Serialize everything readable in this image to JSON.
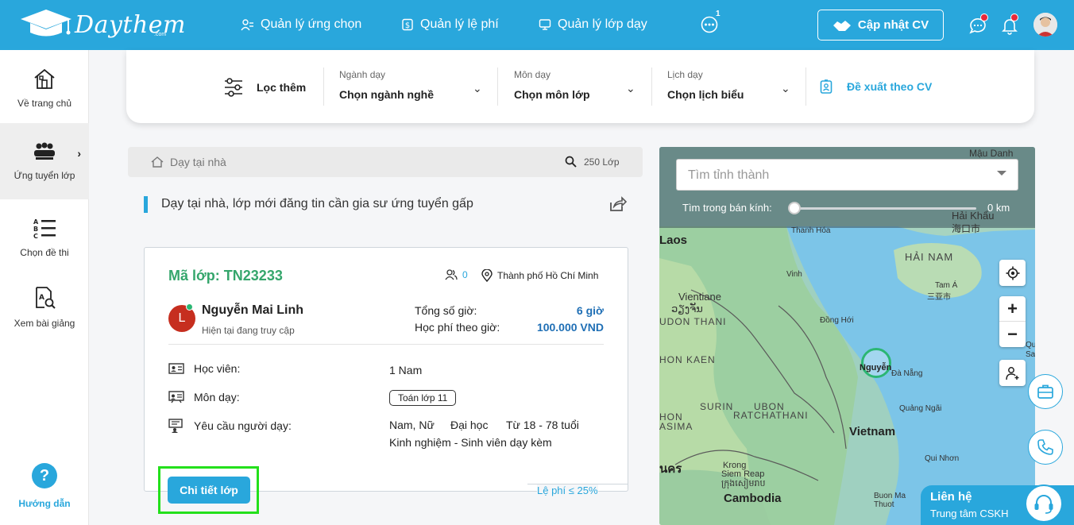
{
  "brand": {
    "name": "Daythem",
    "suffix": ".com"
  },
  "header": {
    "nav": [
      {
        "label": "Quản lý ứng chọn",
        "icon": "people-list-icon"
      },
      {
        "label": "Quản lý lệ phí",
        "icon": "dollar-doc-icon"
      },
      {
        "label": "Quản lý lớp dạy",
        "icon": "screen-icon"
      }
    ],
    "more_badge": "1",
    "cv_button": "Cập nhật CV"
  },
  "sidebar": {
    "items": [
      {
        "label": "Về trang chủ",
        "icon": "home-icon"
      },
      {
        "label": "Ứng tuyển lớp",
        "icon": "group-icon"
      },
      {
        "label": "Chọn đề thi",
        "icon": "abc-list-icon"
      },
      {
        "label": "Xem bài giảng",
        "icon": "lesson-search-icon"
      }
    ],
    "help": "Hướng dẫn",
    "help_symbol": "?"
  },
  "filter": {
    "more_label": "Lọc thêm",
    "groups": [
      {
        "label": "Ngành dạy",
        "value": "Chọn ngành nghề"
      },
      {
        "label": "Môn dạy",
        "value": "Chọn môn lớp"
      },
      {
        "label": "Lịch dạy",
        "value": "Chọn lịch biểu"
      }
    ],
    "suggest": "Đề xuất theo CV"
  },
  "search": {
    "placeholder": "Dạy tại nhà",
    "count": "250 Lớp"
  },
  "section_title": "Dạy tại nhà, lớp mới đăng tin cần gia sư ứng tuyển gấp",
  "card": {
    "code": "Mã lớp: TN23233",
    "applicants": "0",
    "location": "Thành phố Hồ Chí Minh",
    "tutor": {
      "initial": "L",
      "name": "Nguyễn Mai Linh",
      "status": "Hiện tại đang truy cập"
    },
    "total_hours_label": "Tổng số giờ:",
    "total_hours": "6 giờ",
    "fee_label": "Học phí theo giờ:",
    "fee": "100.000 VND",
    "student_label": "Học viên:",
    "student_value": "1 Nam",
    "subject_label": "Môn dạy:",
    "subject_value": "Toán lớp 11",
    "req_label": "Yêu cầu người dạy:",
    "req_gender": "Nam, Nữ",
    "req_level": "Đại học",
    "req_age": "Từ 18 - 78 tuổi",
    "req_exp": "Kinh nghiệm - Sinh viên dạy kèm",
    "detail_button": "Chi tiết lớp",
    "fee_note": "Lệ phí ≤ 25%"
  },
  "map": {
    "province_placeholder": "Tìm tỉnh thành",
    "radius_label": "Tìm trong bán kính:",
    "radius_value": "0 km",
    "radius_fraction": 0,
    "labels": {
      "mau_danh": "Mậu Danh",
      "hai_khau": "Hải Khẩu",
      "hai_khau_cn": "海口市",
      "laos": "Laos",
      "thanh_hoa": "Thanh Hóa",
      "hai_nam": "HẢI NAM",
      "vinh": "Vinh",
      "tam_a": "Tam Á",
      "tam_a_cn": "三亚市",
      "vientiane": "Vientiane",
      "vientiane_lo": "ວຽງຈັນ",
      "udon_thani": "UDON THANI",
      "dong_hoi": "Đồng Hới",
      "hon_kaen": "HON KAEN",
      "nguyen": "Nguyễn",
      "da_nang": "Đà Nẵng",
      "surin": "SURIN",
      "ubon": "UBON",
      "ratchathani": "RATCHATHANI",
      "quang_ngai": "Quảng Ngãi",
      "hon": "HON",
      "asima": "ASIMA",
      "vietnam": "Vietnam",
      "thai_frag": "ูนคร",
      "quy_nhon": "Qui Nhơn",
      "krong": "Krong",
      "siem_reap": "Siem Reap",
      "siem_reap_km": "ក្រុងសៀមរាប",
      "cambodia": "Cambodia",
      "buon_ma": "Buon Ma",
      "thuot": "Thuot",
      "qu": "Qu",
      "sa": "Sa"
    }
  },
  "contact": {
    "title": "Liên hệ",
    "subtitle": "Trung tâm CSKH"
  },
  "colors": {
    "primary": "#29a7dc",
    "green": "#35a66c",
    "highlight": "#23e01b",
    "fee_blue": "#1f6fb5",
    "alert": "#e8283a"
  }
}
